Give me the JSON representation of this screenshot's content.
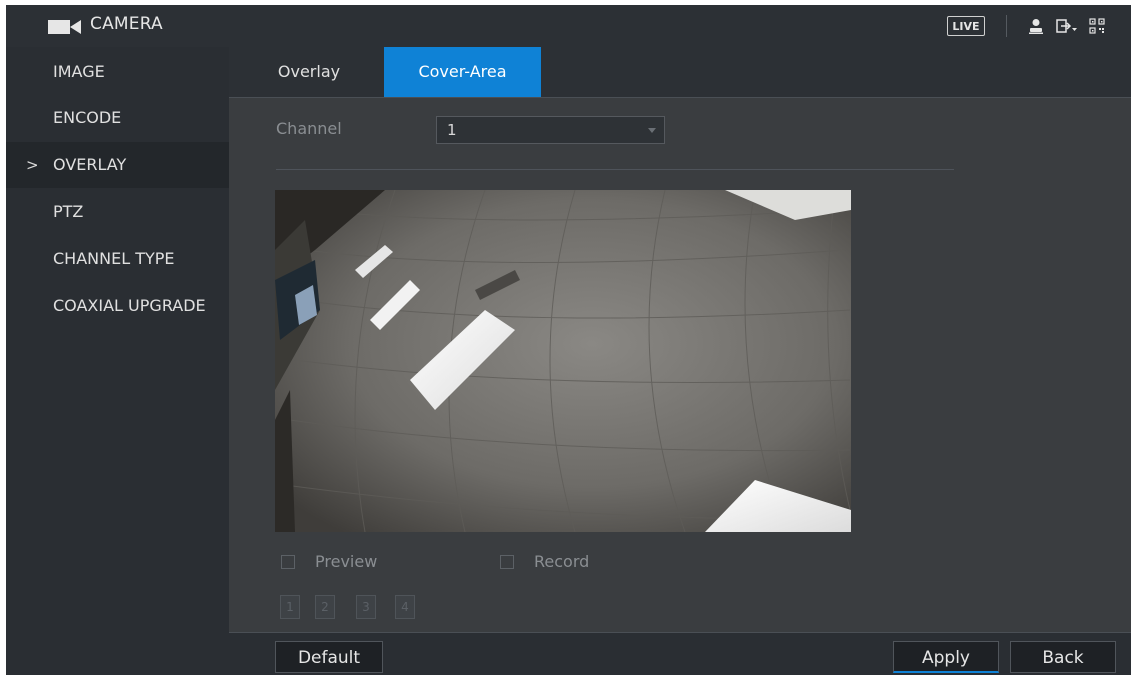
{
  "app": {
    "title": "CAMERA"
  },
  "topbar": {
    "live_label": "LIVE"
  },
  "sidebar": {
    "items": [
      {
        "label": "IMAGE",
        "active": false
      },
      {
        "label": "ENCODE",
        "active": false
      },
      {
        "label": "OVERLAY",
        "active": true
      },
      {
        "label": "PTZ",
        "active": false
      },
      {
        "label": "CHANNEL TYPE",
        "active": false
      },
      {
        "label": "COAXIAL UPGRADE",
        "active": false
      }
    ],
    "active_marker": ">"
  },
  "tabs": [
    {
      "label": "Overlay",
      "active": false
    },
    {
      "label": "Cover-Area",
      "active": true
    }
  ],
  "form": {
    "channel_label": "Channel",
    "channel_value": "1",
    "preview_label": "Preview",
    "record_label": "Record",
    "area_numbers": [
      "1",
      "2",
      "3",
      "4"
    ]
  },
  "buttons": {
    "default": "Default",
    "apply": "Apply",
    "back": "Back"
  },
  "colors": {
    "accent": "#0f82d6",
    "sidebar": "#2a2e33",
    "content": "#3a3d40"
  },
  "icons": [
    "camera-icon",
    "user-icon",
    "logout-icon",
    "qr-code-icon",
    "dropdown-arrow-icon",
    "checkbox-icon"
  ]
}
